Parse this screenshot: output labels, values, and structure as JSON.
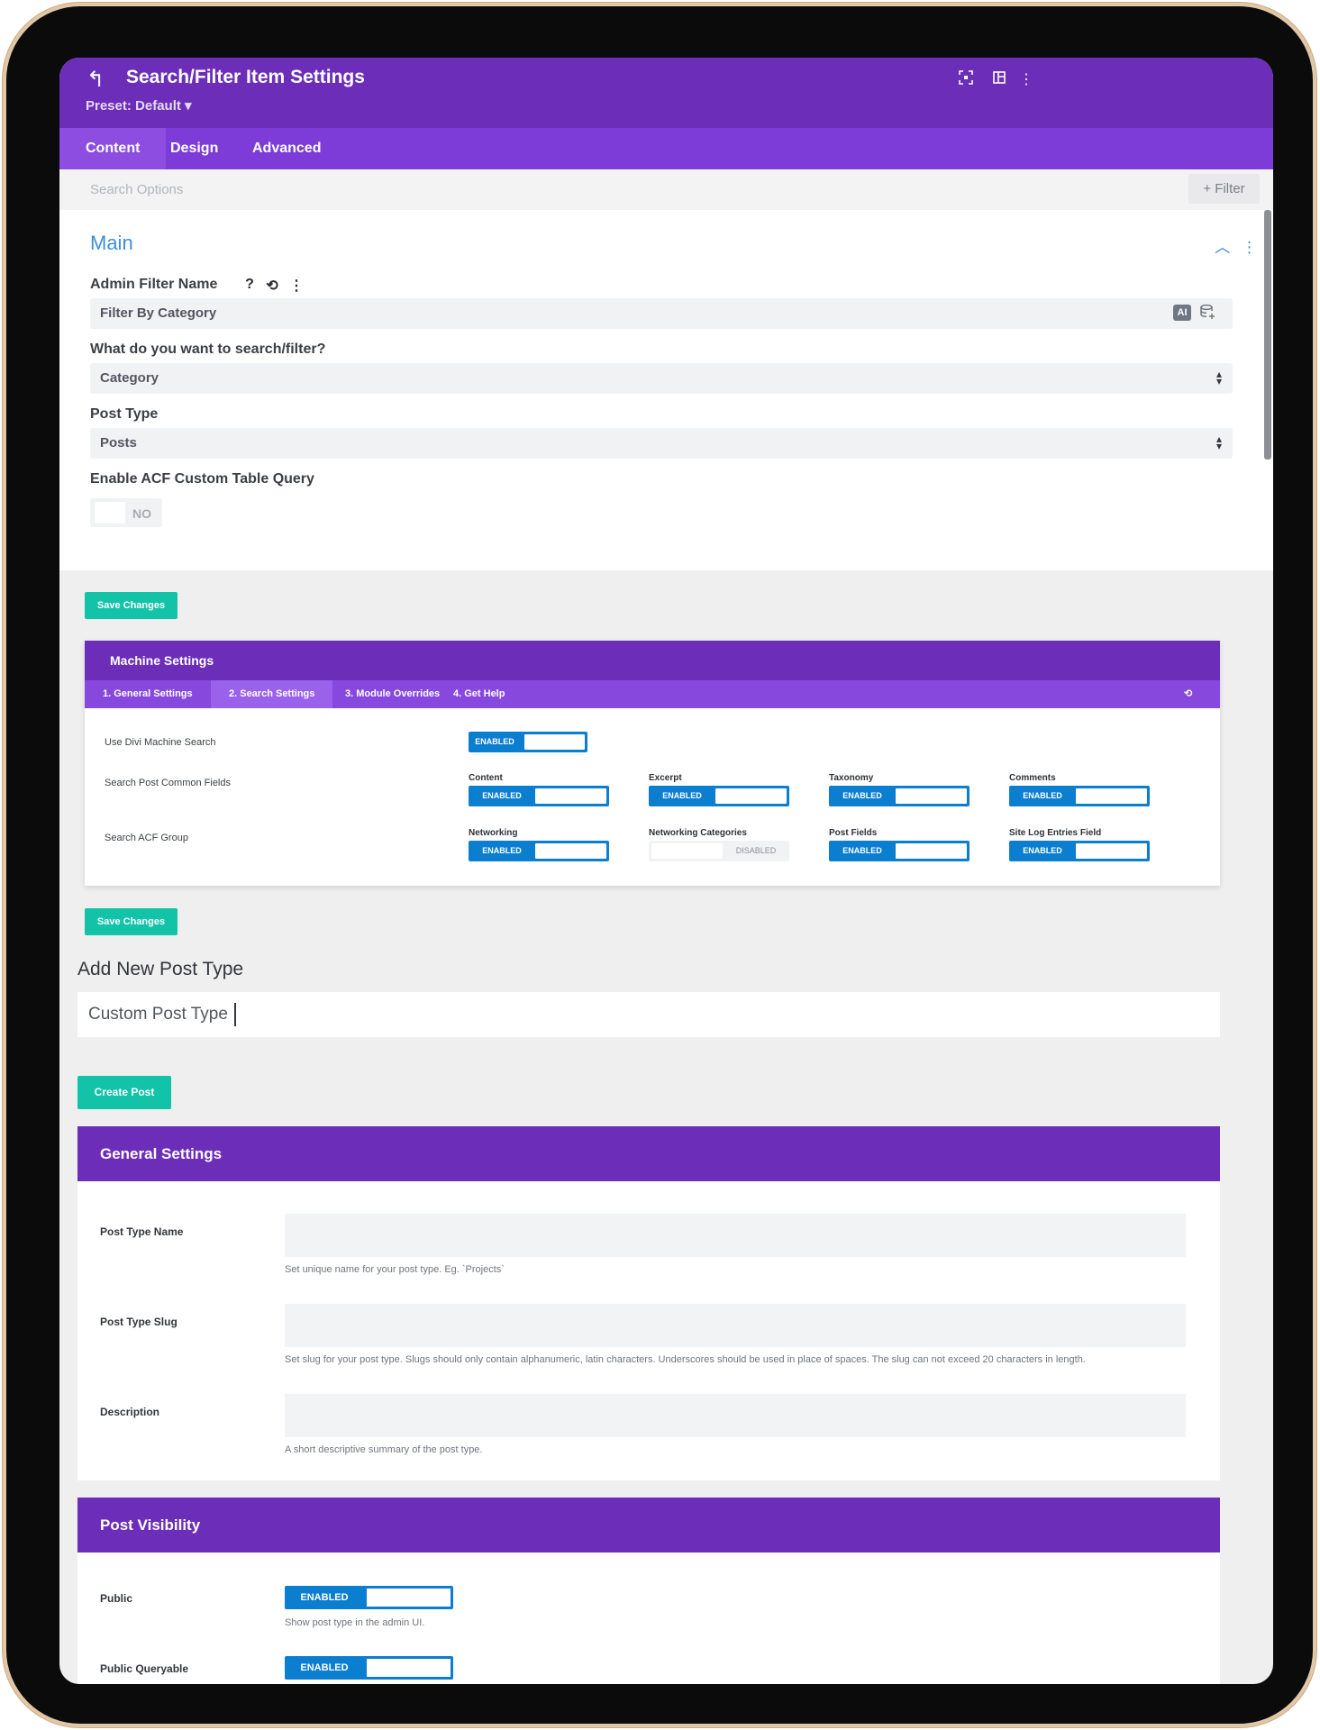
{
  "header": {
    "title": "Search/Filter Item Settings",
    "preset": "Preset: Default ▾",
    "back_icon": "undo-arrow-icon",
    "icons": [
      "focus-icon",
      "columns-icon",
      "more-vertical-icon"
    ]
  },
  "tabs": [
    {
      "label": "Content",
      "active": true
    },
    {
      "label": "Design",
      "active": false
    },
    {
      "label": "Advanced",
      "active": false
    }
  ],
  "search": {
    "placeholder": "Search Options",
    "filter_label": "+ Filter"
  },
  "main": {
    "title": "Main",
    "admin_filter_name_label": "Admin Filter Name",
    "admin_filter_name_value": "Filter By Category",
    "ai_badge": "AI",
    "search_filter_label": "What do you want to search/filter?",
    "search_filter_value": "Category",
    "post_type_label": "Post Type",
    "post_type_value": "Posts",
    "acf_label": "Enable ACF Custom Table Query",
    "acf_value": "NO"
  },
  "save_label": "Save Changes",
  "machine": {
    "title": "Machine Settings",
    "tabs": [
      "1. General Settings",
      "2. Search Settings",
      "3. Module Overrides",
      "4. Get Help"
    ],
    "active_tab": 1,
    "use_divi_label": "Use Divi Machine Search",
    "use_divi_value": "ENABLED",
    "common_fields_label": "Search Post Common Fields",
    "acf_group_label": "Search ACF Group",
    "common_fields": [
      {
        "name": "Content",
        "state": "ENABLED"
      },
      {
        "name": "Excerpt",
        "state": "ENABLED"
      },
      {
        "name": "Taxonomy",
        "state": "ENABLED"
      },
      {
        "name": "Comments",
        "state": "ENABLED"
      }
    ],
    "acf_fields": [
      {
        "name": "Networking",
        "state": "ENABLED"
      },
      {
        "name": "Networking Categories",
        "state": "DISABLED"
      },
      {
        "name": "Post Fields",
        "state": "ENABLED"
      },
      {
        "name": "Site Log Entries Field",
        "state": "ENABLED"
      }
    ]
  },
  "add_post_type": {
    "title": "Add New Post Type",
    "value": "Custom Post Type",
    "create_label": "Create Post"
  },
  "general_settings": {
    "title": "General Settings",
    "fields": [
      {
        "label": "Post Type Name",
        "help": "Set unique name for your post type. Eg. `Projects`"
      },
      {
        "label": "Post Type Slug",
        "help": "Set slug for your post type. Slugs should only contain alphanumeric, latin characters. Underscores should be used in place of spaces. The slug can not exceed 20 characters in length."
      },
      {
        "label": "Description",
        "help": "A short descriptive summary of the post type."
      }
    ]
  },
  "post_visibility": {
    "title": "Post Visibility",
    "public_label": "Public",
    "public_value": "ENABLED",
    "public_help": "Show post type in the admin UI.",
    "queryable_label": "Public Queryable",
    "queryable_value": "ENABLED"
  },
  "colors": {
    "purple": "#6c2eb9",
    "tab_purple": "#7d3bd8",
    "teal": "#12c3a8",
    "toggle_blue": "#0c7ed0",
    "link_blue": "#3d8fd6"
  }
}
